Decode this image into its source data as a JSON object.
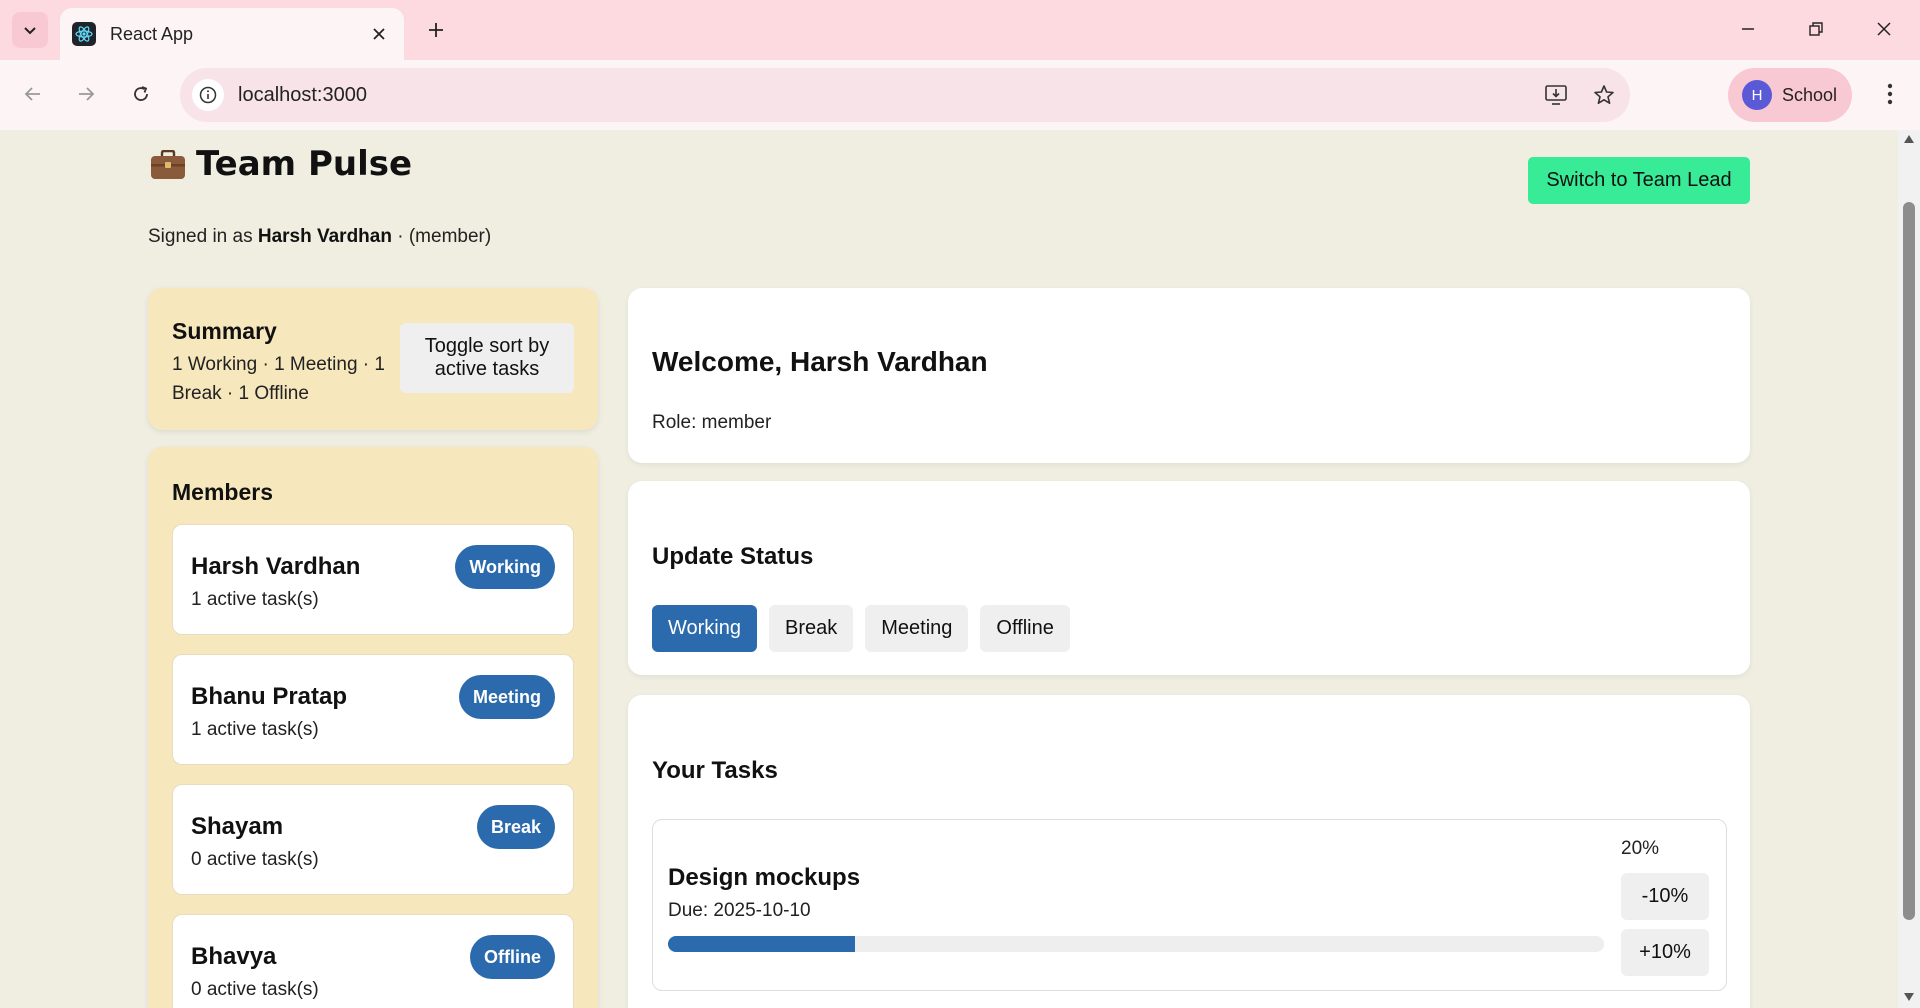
{
  "browser": {
    "tab_title": "React App",
    "url": "localhost:3000",
    "profile_initial": "H",
    "profile_name": "School"
  },
  "header": {
    "app_title": "Team Pulse",
    "switch_button": "Switch to Team Lead",
    "signed_in_prefix": "Signed in as ",
    "user_name": "Harsh Vardhan",
    "role_suffix": " · (member)"
  },
  "summary": {
    "title": "Summary",
    "text": "1 Working · 1 Meeting · 1 Break · 1 Offline",
    "toggle_button": "Toggle sort by active tasks"
  },
  "members": {
    "title": "Members",
    "items": [
      {
        "name": "Harsh Vardhan",
        "tasks": "1 active task(s)",
        "status": "Working"
      },
      {
        "name": "Bhanu Pratap",
        "tasks": "1 active task(s)",
        "status": "Meeting"
      },
      {
        "name": "Shayam",
        "tasks": "0 active task(s)",
        "status": "Break"
      },
      {
        "name": "Bhavya",
        "tasks": "0 active task(s)",
        "status": "Offline"
      }
    ]
  },
  "welcome": {
    "heading": "Welcome, Harsh Vardhan",
    "role": "Role: member"
  },
  "status": {
    "title": "Update Status",
    "options": [
      "Working",
      "Break",
      "Meeting",
      "Offline"
    ],
    "active": "Working"
  },
  "tasks": {
    "title": "Your Tasks",
    "items": [
      {
        "name": "Design mockups",
        "due": "Due: 2025-10-10",
        "percent_label": "20%",
        "progress": 0.2,
        "decrease_label": "-10%",
        "increase_label": "+10%"
      }
    ]
  },
  "colors": {
    "accent_blue": "#2b6aad",
    "switch_green": "#38eb96",
    "sidebar_card": "#f6e7bd",
    "page_bg": "#efeee1"
  }
}
